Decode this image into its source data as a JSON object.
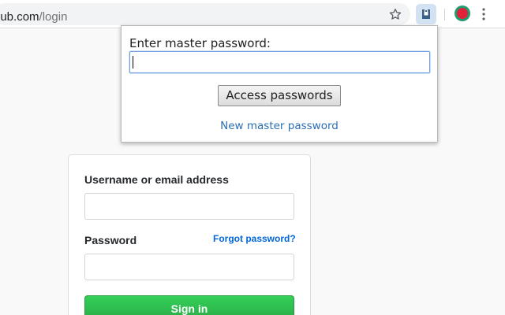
{
  "browser": {
    "url_host": "hub.com",
    "url_path": "/login",
    "icons": {
      "bookmark": "star-icon",
      "extension": "lock-extension-icon",
      "profile": "profile-avatar-icon",
      "menu": "kebab-menu-icon"
    },
    "accent_color": "#d3e2f3"
  },
  "popup": {
    "title": "Enter master password:",
    "password_value": "",
    "access_button_label": "Access passwords",
    "new_master_link": "New master password"
  },
  "login": {
    "username_label": "Username or email address",
    "username_value": "",
    "password_label": "Password",
    "password_value": "",
    "forgot_link": "Forgot password?",
    "sign_in_label": "Sign in",
    "sign_in_color": "#2ea44f",
    "link_color": "#0366d6"
  }
}
